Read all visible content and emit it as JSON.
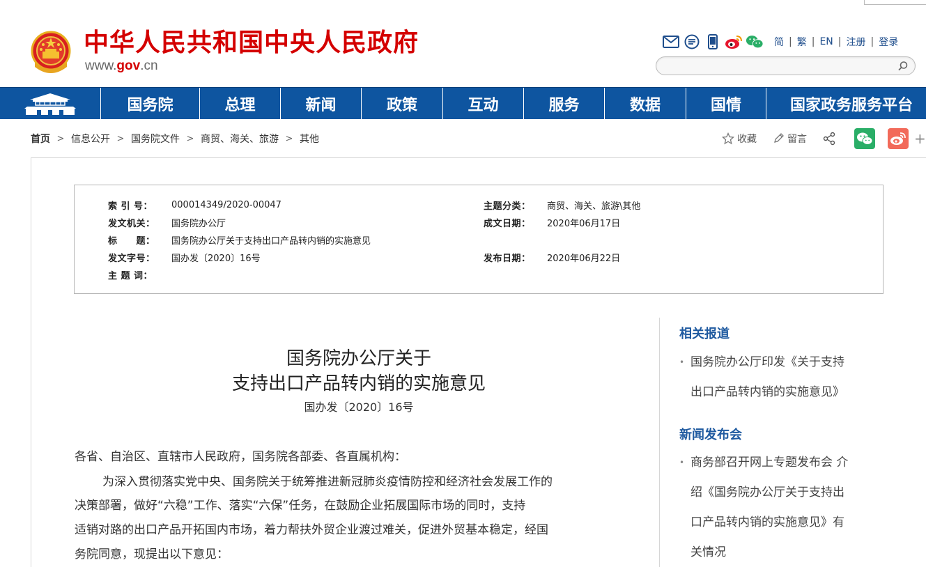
{
  "header": {
    "site_title": "中华人民共和国中央人民政府",
    "domain_pre": "www.",
    "domain_mid": "gov",
    "domain_post": ".cn",
    "tool_icons": [
      "mail-icon",
      "chat-icon",
      "mobile-icon",
      "weibo-icon",
      "wechat-icon"
    ],
    "lang_links": [
      "简",
      "繁",
      "EN",
      "注册",
      "登录"
    ],
    "search_placeholder": ""
  },
  "nav": {
    "items": [
      "国务院",
      "总理",
      "新闻",
      "政策",
      "互动",
      "服务",
      "数据",
      "国情",
      "国家政务服务平台"
    ]
  },
  "breadcrumb": [
    "首页",
    "信息公开",
    "国务院文件",
    "商贸、海关、旅游",
    "其他"
  ],
  "actions": {
    "favorite": "收藏",
    "comment": "留言",
    "more": "+"
  },
  "meta": {
    "index_label": "索 引 号：",
    "index_value": "000014349/2020-00047",
    "category_label": "主题分类：",
    "category_value": "商贸、海关、旅游\\其他",
    "issuer_label": "发文机关：",
    "issuer_value": "国务院办公厅",
    "date_written_label": "成文日期：",
    "date_written_value": "2020年06月17日",
    "title_label": "标　　题：",
    "title_value": "国务院办公厅关于支持出口产品转内销的实施意见",
    "doc_no_label": "发文字号：",
    "doc_no_value": "国办发〔2020〕16号",
    "publish_label": "发布日期：",
    "publish_value": "2020年06月22日",
    "keywords_label": "主 题 词："
  },
  "document": {
    "title_line1": "国务院办公厅关于",
    "title_line2": "支持出口产品转内销的实施意见",
    "doc_number": "国办发〔2020〕16号",
    "salutation": "各省、自治区、直辖市人民政府，国务院各部委、各直属机构：",
    "paragraph1_lines": [
      "为深入贯彻落实党中央、国务院关于统筹推进新冠肺炎疫情防控和经济社会发展工作的",
      "决策部署，做好“六稳”工作、落实“六保”任务，在鼓励企业拓展国际市场的同时，支持",
      "适销对路的出口产品开拓国内市场，着力帮扶外贸企业渡过难关，促进外贸基本稳定，经国",
      "务院同意，现提出以下意见："
    ]
  },
  "sidebar": {
    "related_heading": "相关报道",
    "related_item_lines": [
      "国务院办公厅印发《关于支持",
      "出口产品转内销的实施意见》"
    ],
    "press_heading": "新闻发布会",
    "press_item_lines": [
      "商务部召开网上专题发布会 介",
      "绍《国务院办公厅关于支持出",
      "口产品转内销的实施意见》有",
      "关情况"
    ]
  },
  "colors": {
    "brand_red": "#d40000",
    "nav_blue": "#0e55a0",
    "link_blue": "#1f5aa0",
    "wechat_green": "#2aae67",
    "weibo_red": "#f26a5a"
  }
}
